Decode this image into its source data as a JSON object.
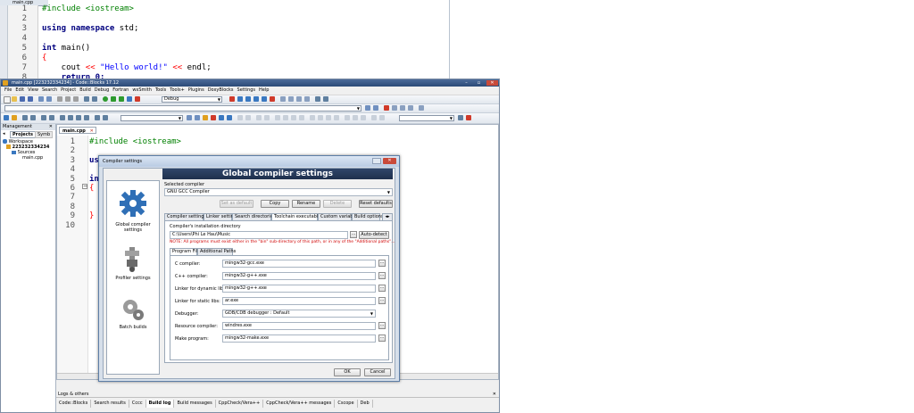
{
  "background_window": {
    "tab_label": "main.cpp",
    "line_numbers": [
      "1",
      "2",
      "3",
      "4",
      "5",
      "6",
      "7",
      "8"
    ],
    "code_lines": [
      {
        "segments": [
          {
            "t": "#include <iostream>",
            "c": "pp"
          }
        ]
      },
      {
        "segments": []
      },
      {
        "segments": [
          {
            "t": "using namespace",
            "c": "kw"
          },
          {
            "t": " std;",
            "c": ""
          }
        ]
      },
      {
        "segments": []
      },
      {
        "segments": [
          {
            "t": "int",
            "c": "kw"
          },
          {
            "t": " main()",
            "c": ""
          }
        ]
      },
      {
        "segments": [
          {
            "t": "{",
            "c": "op"
          }
        ]
      },
      {
        "segments": [
          {
            "t": "    cout ",
            "c": ""
          },
          {
            "t": "<<",
            "c": "op"
          },
          {
            "t": " ",
            "c": ""
          },
          {
            "t": "\"Hello world!\"",
            "c": "str"
          },
          {
            "t": " ",
            "c": ""
          },
          {
            "t": "<<",
            "c": "op"
          },
          {
            "t": " endl;",
            "c": ""
          }
        ]
      },
      {
        "segments": [
          {
            "t": "    return 0;",
            "c": "kw"
          }
        ]
      }
    ]
  },
  "main_window": {
    "title": "main.cpp [223232334234] - Code::Blocks 17.12",
    "controls": {
      "minimize": "–",
      "maximize": "▫",
      "close": "✕"
    },
    "menu": [
      "File",
      "Edit",
      "View",
      "Search",
      "Project",
      "Build",
      "Debug",
      "Fortran",
      "wxSmith",
      "Tools",
      "Tools+",
      "Plugins",
      "DoxyBlocks",
      "Settings",
      "Help"
    ],
    "build_target": "Debug",
    "management": {
      "title": "Management",
      "close": "✕",
      "tabs": [
        "Projects",
        "Symb"
      ],
      "tree": [
        "Workspace",
        "223232334234",
        "Sources",
        "main.cpp"
      ]
    },
    "editor": {
      "tab_label": "main.cpp",
      "tab_close": "✕",
      "line_numbers": [
        "1",
        "2",
        "3",
        "4",
        "5",
        "6",
        "7",
        "8",
        "9",
        "10"
      ],
      "code_lines": [
        {
          "segments": [
            {
              "t": "#include <iostream>",
              "c": "pp"
            }
          ]
        },
        {
          "segments": []
        },
        {
          "segments": [
            {
              "t": "us",
              "c": "kw"
            }
          ]
        },
        {
          "segments": []
        },
        {
          "segments": [
            {
              "t": "in",
              "c": "kw"
            }
          ]
        },
        {
          "segments": [
            {
              "t": "{",
              "c": "op"
            }
          ]
        },
        {
          "segments": []
        },
        {
          "segments": []
        },
        {
          "segments": [
            {
              "t": "}",
              "c": "op"
            }
          ]
        },
        {
          "segments": []
        }
      ]
    },
    "logs": {
      "title": "Logs & others",
      "close": "✕",
      "tabs": [
        "Code::Blocks",
        "Search results",
        "Cccc",
        "Build log",
        "Build messages",
        "CppCheck/Vera++",
        "CppCheck/Vera++ messages",
        "Cscope",
        "Deb"
      ],
      "active_tab": "Build log"
    }
  },
  "dialog": {
    "window_title": "Compiler settings",
    "header": "Global compiler settings",
    "sidebar": [
      {
        "label": "Global compiler settings",
        "icon": "gear-icon"
      },
      {
        "label": "Profiler settings",
        "icon": "profiler-icon"
      },
      {
        "label": "Batch builds",
        "icon": "gears-icon"
      }
    ],
    "selected_compiler_label": "Selected compiler",
    "selected_compiler": "GNU GCC Compiler",
    "buttons": {
      "set_default": "Set as default",
      "copy": "Copy",
      "rename": "Rename",
      "delete": "Delete",
      "reset_defaults": "Reset defaults",
      "auto_detect": "Auto-detect",
      "ok": "OK",
      "cancel": "Cancel",
      "browse": "..."
    },
    "tabs": [
      "Compiler settings",
      "Linker settings",
      "Search directories",
      "Toolchain executables",
      "Custom variables",
      "Build options"
    ],
    "active_tab": "Toolchain executables",
    "install_dir_label": "Compiler's installation directory",
    "install_dir": "C:\\Users\\Phi Le Hau\\Music",
    "note": "NOTE: All programs must exist either in the \"bin\" sub-directory of this path, or in any of the \"Additional paths\"...",
    "subtabs": [
      "Program Files",
      "Additional Paths"
    ],
    "active_subtab": "Program Files",
    "programs": [
      {
        "label": "C compiler:",
        "value": "mingw32-gcc.exe"
      },
      {
        "label": "C++ compiler:",
        "value": "mingw32-g++.exe"
      },
      {
        "label": "Linker for dynamic libs:",
        "value": "mingw32-g++.exe"
      },
      {
        "label": "Linker for static libs:",
        "value": "ar.exe"
      },
      {
        "label": "Debugger:",
        "value": "GDB/CDB debugger : Default"
      },
      {
        "label": "Resource compiler:",
        "value": "windres.exe"
      },
      {
        "label": "Make program:",
        "value": "mingw32-make.exe"
      }
    ]
  },
  "colors": {
    "accent": "#2b4a78",
    "dialog_header": "#1e2f4c",
    "error_text": "#d00000"
  }
}
